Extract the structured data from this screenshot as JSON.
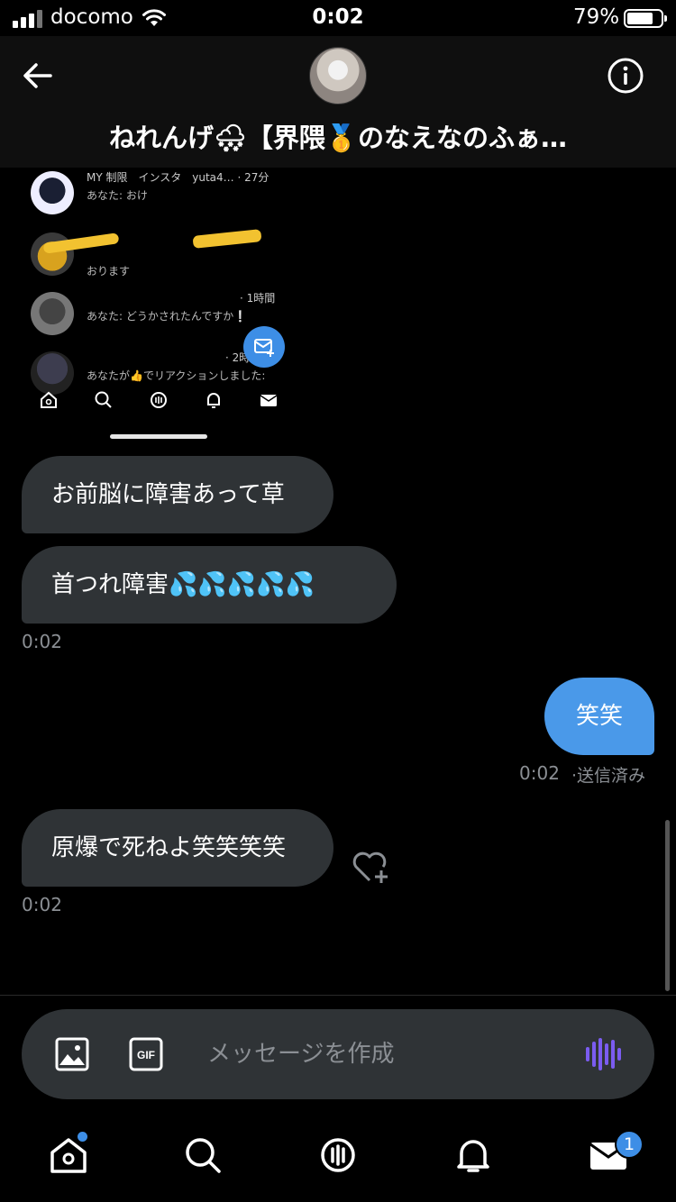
{
  "status_bar": {
    "carrier": "docomo",
    "time": "0:02",
    "battery": "79%",
    "battery_level": 0.79
  },
  "header": {
    "title": "ねれんげ🌨【界隈🥇のなえなのふぁ…"
  },
  "shared_screenshot": {
    "rows": [
      {
        "name": "MY 制限　インスタ　yuta4… · 27分",
        "preview": "あなた: おけ"
      },
      {
        "name": "",
        "preview": "おります"
      },
      {
        "name": "· 1時間",
        "preview": "あなた: どうかされたんですか❕"
      },
      {
        "name": "· 2時間",
        "preview": "あなたが👍でリアクションしました:"
      }
    ]
  },
  "messages": [
    {
      "text": "お前脳に障害あって草"
    },
    {
      "text": "首つれ障害💦💦💦💦💦",
      "time": "0:02"
    },
    {
      "text": "笑笑",
      "time": "0:02",
      "status": "·送信済み"
    },
    {
      "text": "原爆で死ねよ笑笑笑笑",
      "time": "0:02"
    }
  ],
  "composer": {
    "placeholder": "メッセージを作成",
    "gif_label": "GIF"
  },
  "tabbar": {
    "messages_badge": "1"
  },
  "colors": {
    "accent": "#3d8ee6",
    "bubble_received": "#2f3336",
    "bubble_sent": "#4a99e9",
    "voice": "#7b5cf0"
  }
}
